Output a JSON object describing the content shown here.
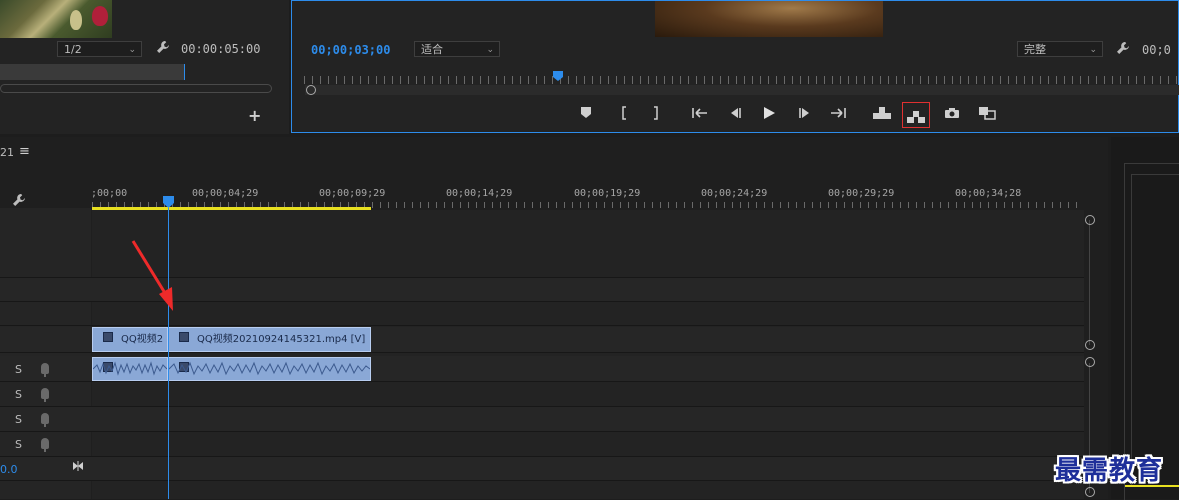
{
  "source": {
    "resolution_value": "1/2",
    "timecode": "00:00:05:00",
    "add_glyph": "+"
  },
  "program": {
    "timecode": "00;00;03;00",
    "fit_value": "适合",
    "quality_value": "完整",
    "timecode_right": "00;0",
    "playhead_fraction": 0.293
  },
  "timeline": {
    "sequence_tab_fragment": "21",
    "menu_glyph": "≡",
    "ruler_labels": [
      ";00;00",
      "00;00;04;29",
      "00;00;09;29",
      "00;00;14;29",
      "00;00;19;29",
      "00;00;24;29",
      "00;00;29;29",
      "00;00;34;28"
    ],
    "video_clip_a_label": "QQ视频2",
    "video_clip_b_label": "QQ视频20210924145321.mp4 [V]",
    "audio_track_buttons": [
      "S",
      "S",
      "S",
      "S"
    ],
    "volume_fragment": "0.0"
  },
  "watermark": "最需教育",
  "colors": {
    "accent": "#2d8ceb",
    "work_area": "#e8e020",
    "clip": "#8aa8d6",
    "highlight_box": "#e03030",
    "arrow": "#ee2a2a"
  }
}
